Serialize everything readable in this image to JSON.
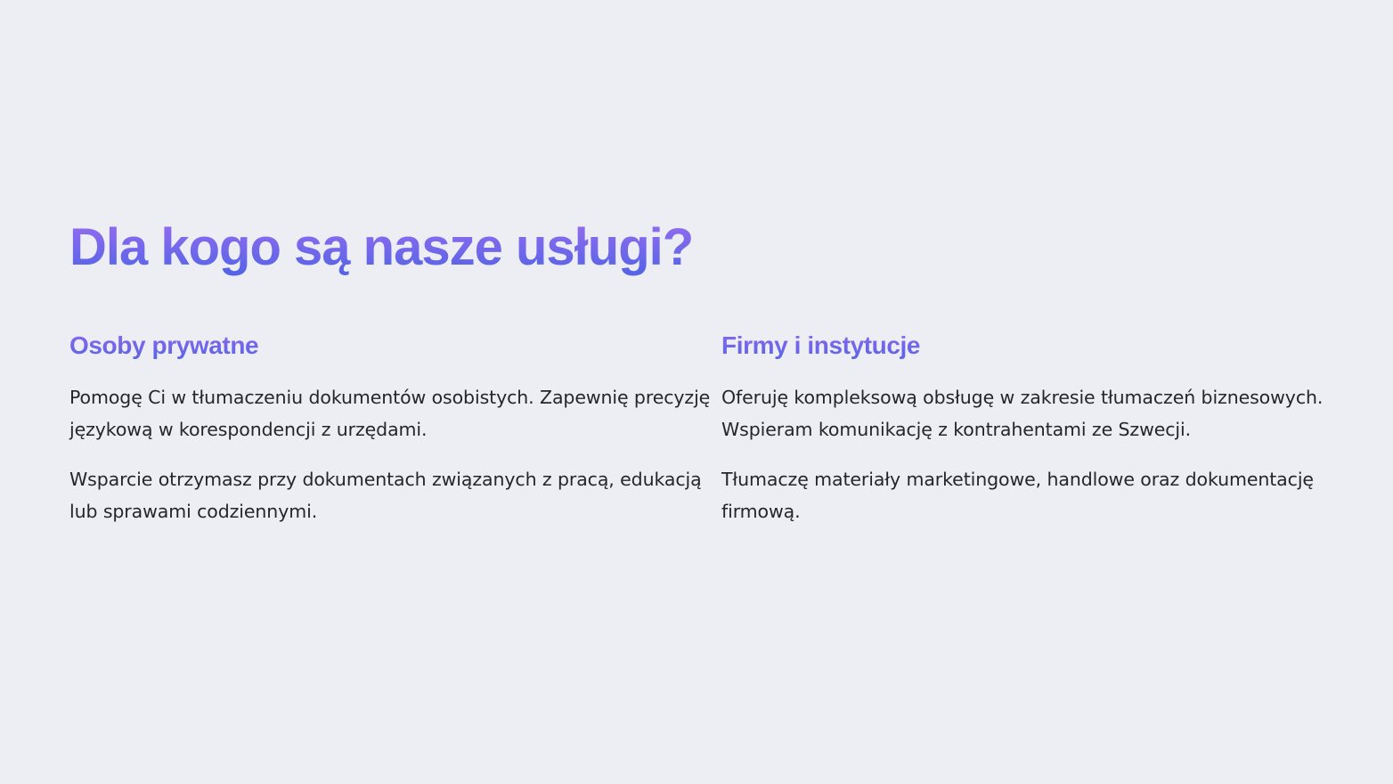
{
  "page": {
    "title": "Dla kogo są nasze usługi?"
  },
  "columns": [
    {
      "heading": "Osoby prywatne",
      "paragraphs": [
        "Pomogę Ci w tłumaczeniu dokumentów osobistych. Zapewnię precyzję językową w korespondencji z urzędami.",
        "Wsparcie otrzymasz przy dokumentach związanych z pracą, edukacją lub sprawami codziennymi."
      ]
    },
    {
      "heading": "Firmy i instytucje",
      "paragraphs": [
        "Oferuję kompleksową obsługę w zakresie tłumaczeń biznesowych. Wspieram komunikację z kontrahentami ze Szwecji.",
        "Tłumaczę materiały marketingowe, handlowe oraz dokumentację firmową."
      ]
    }
  ],
  "colors": {
    "background": "#edeef3",
    "gradient_start": "#9a6cf0",
    "gradient_end": "#4f63e6",
    "body_text": "#25252d"
  }
}
